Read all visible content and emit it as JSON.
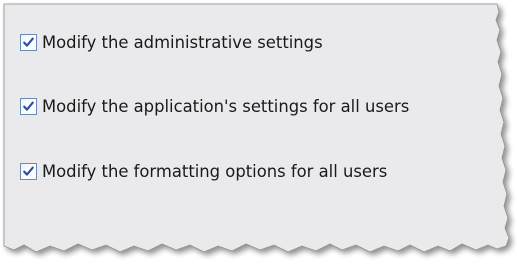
{
  "options": [
    {
      "label": "Modify the administrative settings",
      "checked": true
    },
    {
      "label": "Modify the application's settings for all users",
      "checked": true
    },
    {
      "label": "Modify the formatting options for all users",
      "checked": true
    }
  ],
  "colors": {
    "panel_background": "#eaeaec",
    "checkbox_border": "#6b8bb5",
    "check_mark": "#2b4aa8",
    "text": "#1a1a1a",
    "panel_edge": "#8c8c8c"
  }
}
